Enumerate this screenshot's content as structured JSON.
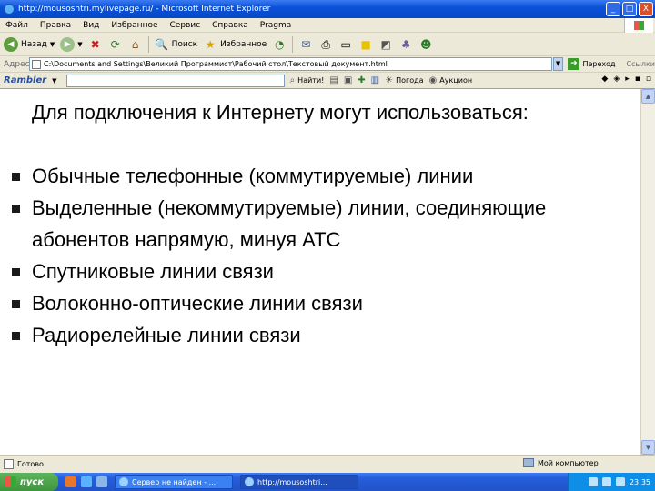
{
  "window": {
    "title": "http://mousoshtri.mylivepage.ru/ - Microsoft Internet Explorer",
    "controls": [
      "_",
      "□",
      "X"
    ]
  },
  "menu": [
    "Файл",
    "Правка",
    "Вид",
    "Избранное",
    "Сервис",
    "Справка",
    "Pragma"
  ],
  "toolbar": {
    "back_label": "Назад",
    "search_label": "Поиск",
    "favorites_label": "Избранное"
  },
  "address": {
    "label": "Адрес:",
    "value": "C:\\Documents and Settings\\Великий Программист\\Рабочий стол\\Текстовый документ.html",
    "go_label": "Переход",
    "links_label": "Ссылки"
  },
  "rambler": {
    "logo": "Rambler",
    "find_label": "Найти!",
    "btn2": "Погода",
    "btn3": "Аукцион"
  },
  "content": {
    "heading": "Для подключения к Интернету могут использоваться:",
    "bullets": [
      "Обычные телефонные (коммутируемые) линии",
      "Выделенные (некоммутируемые) линии, соединяющие абонентов напрямую, минуя АТС",
      "Спутниковые линии связи",
      "Волоконно-оптические линии связи",
      "Радиорелейные линии связи"
    ]
  },
  "status": {
    "text": "Готово",
    "zone": "Мой компьютер"
  },
  "taskbar": {
    "start_label": "пуск",
    "tasks": [
      "Сервер не найден - ...",
      "http://mousoshtri..."
    ],
    "clock": "23:35"
  },
  "icons": {
    "ie": "ie-logo-icon",
    "back": "back-arrow-icon",
    "forward": "forward-arrow-icon",
    "stop": "stop-icon",
    "refresh": "refresh-icon",
    "home": "home-icon",
    "search": "search-icon",
    "favorites": "favorites-star-icon",
    "history": "history-icon",
    "mail": "mail-icon",
    "print": "print-icon",
    "edit": "edit-icon",
    "bullet": "square-bullet-icon"
  },
  "colors": {
    "titlebar": "#0a52d8",
    "chrome": "#ece9d8",
    "taskbar": "#245edb",
    "start": "#3e963c"
  }
}
